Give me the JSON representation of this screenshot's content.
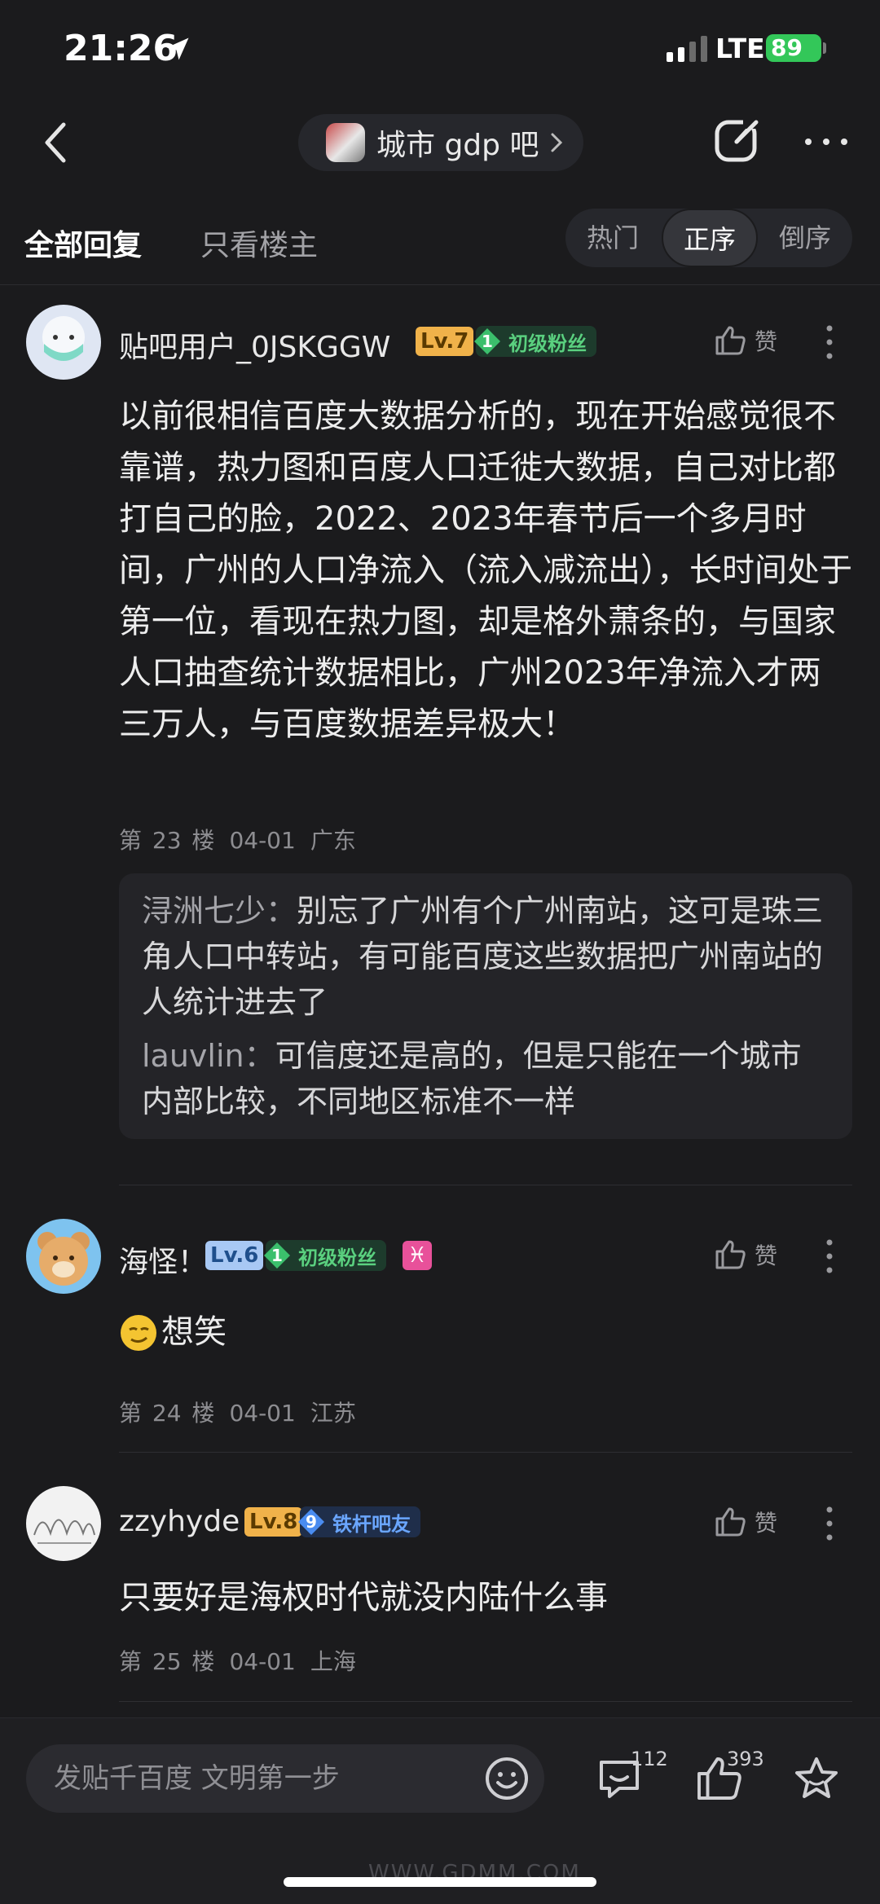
{
  "status_bar": {
    "time": "21:26",
    "network": "LTE",
    "battery": "89"
  },
  "nav": {
    "forum_name": "城市 gdp 吧"
  },
  "tabs": {
    "all_replies": "全部回复",
    "owner_only": "只看楼主"
  },
  "sort": {
    "hot": "热门",
    "asc": "正序",
    "desc": "倒序"
  },
  "posts": [
    {
      "username": "贴吧用户_0JSKGGW",
      "level": "Lv.7",
      "fan_level": "1",
      "fan_label": "初级粉丝",
      "like_label": "赞",
      "content": "以前很相信百度大数据分析的，现在开始感觉很不靠谱，热力图和百度人口迁徙大数据，自己对比都打自己的脸，2022、2023年春节后一个多月时间，广州的人口净流入（流入减流出），长时间处于第一位，看现在热力图，却是格外萧条的，与国家人口抽查统计数据相比，广州2023年净流入才两三万人，与百度数据差异极大！",
      "floor": "第 23 楼",
      "date": "04-01",
      "location": "广东",
      "replies": [
        {
          "name": "浔洲七少",
          "text": "别忘了广州有个广州南站，这可是珠三角人口中转站，有可能百度这些数据把广州南站的人统计进去了"
        },
        {
          "name": "lauvlin",
          "text": "可信度还是高的，但是只能在一个城市内部比较，不同地区标准不一样"
        }
      ]
    },
    {
      "username": "海怪！",
      "level": "Lv.6",
      "fan_level": "1",
      "fan_label": "初级粉丝",
      "zodiac": "♓",
      "like_label": "赞",
      "content": "想笑",
      "floor": "第 24 楼",
      "date": "04-01",
      "location": "江苏"
    },
    {
      "username": "zzyhyde",
      "level": "Lv.8",
      "fan_level": "9",
      "fan_label": "铁杆吧友",
      "like_label": "赞",
      "content": "只要好是海权时代就没内陆什么事",
      "floor": "第 25 楼",
      "date": "04-01",
      "location": "上海"
    }
  ],
  "bottom_bar": {
    "input_placeholder": "发贴千百度 文明第一步",
    "comment_count": "112",
    "like_count": "393"
  },
  "watermark": "WWW.GDMM.COM"
}
